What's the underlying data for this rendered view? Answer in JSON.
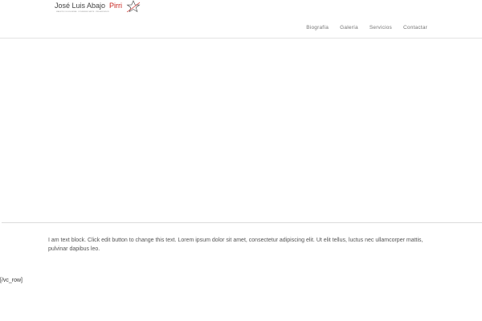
{
  "header": {
    "logo": {
      "name_main": "José Luis Abajo",
      "name_accent": "Pirri",
      "tagline": "MAESTRO DE ESGRIMA · CONFERENCIANTE · PRESENTADOR",
      "accent_color": "#c8231e",
      "icon": "star-icon"
    },
    "nav": [
      {
        "label": "Biografía"
      },
      {
        "label": "Galería"
      },
      {
        "label": "Servicios"
      },
      {
        "label": "Contactar"
      }
    ]
  },
  "content": {
    "text_block": "I am text block. Click edit button to change this text. Lorem ipsum dolor sit amet, consectetur adipiscing elit. Ut elit tellus, luctus nec ullamcorper mattis, pulvinar dapibus leo.",
    "shortcode": "[/vc_row]"
  }
}
